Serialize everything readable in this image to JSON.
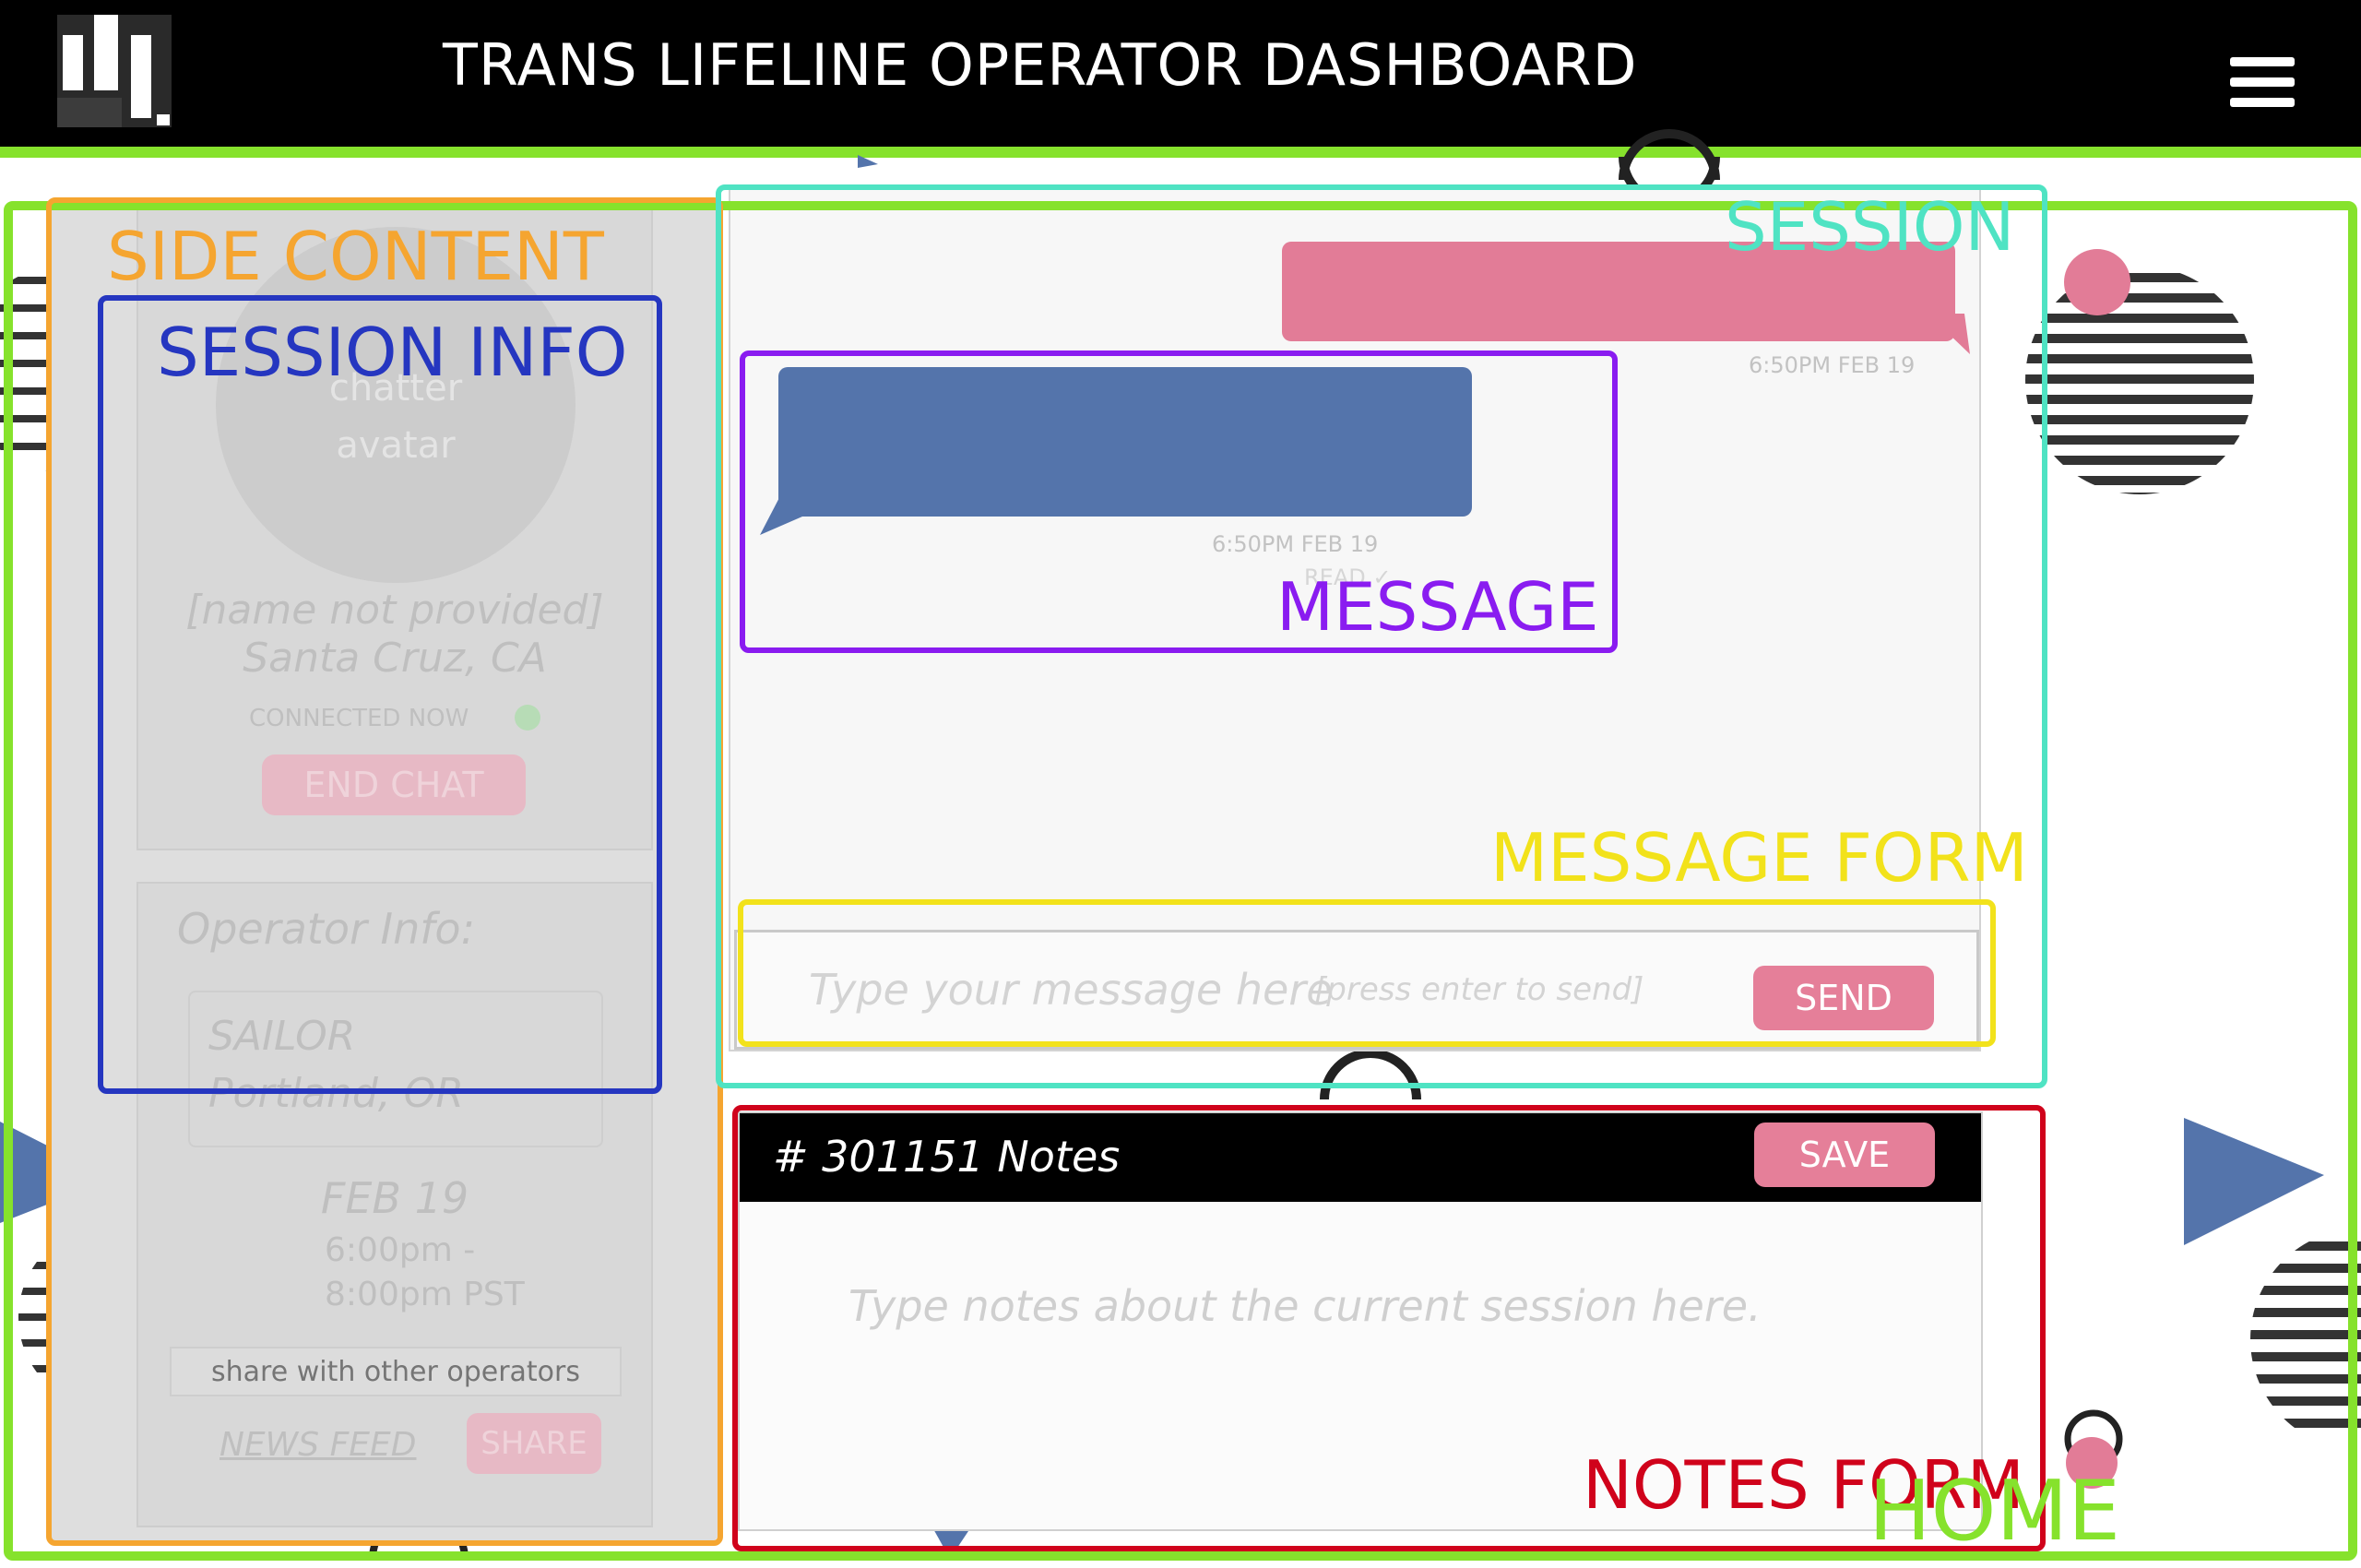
{
  "header": {
    "title": "TRANS LIFELINE OPERATOR DASHBOARD",
    "logo_icon": "trans-lifeline-logo",
    "menu_icon": "hamburger-menu-icon"
  },
  "side_content": {
    "session_info": {
      "avatar_text": "chatter\navatar",
      "name": "[name not provided]",
      "location": "Santa Cruz, CA",
      "status": "CONNECTED NOW",
      "end_chat_label": "END CHAT"
    },
    "operator_info": {
      "heading": "Operator Info:",
      "name": "SAILOR",
      "location": "Portland, OR",
      "shift_date": "FEB 19",
      "shift_time": "6:00pm -\n8:00pm PST",
      "share_placeholder": "share with other operators",
      "news_feed_label": "NEWS FEED",
      "share_label": "SHARE"
    }
  },
  "session": {
    "messages": [
      {
        "direction": "outgoing",
        "timestamp": "6:50PM FEB 19"
      },
      {
        "direction": "incoming",
        "timestamp": "6:50PM FEB 19",
        "read": "READ ✓"
      }
    ],
    "message_form": {
      "placeholder": "Type your message here",
      "hint": "[press enter to send]",
      "send_label": "SEND"
    }
  },
  "notes_form": {
    "title": "# 301151 Notes",
    "save_label": "SAVE",
    "placeholder": "Type notes about the current session here."
  },
  "annotations": {
    "home": "HOME",
    "side_content": "SIDE CONTENT",
    "session_info": "SESSION INFO",
    "session": "SESSION",
    "message": "MESSAGE",
    "message_form": "MESSAGE FORM",
    "notes_form": "NOTES FORM"
  },
  "colors": {
    "home": "#86e22c",
    "side_content": "#f5a530",
    "session_info": "#2536c0",
    "session": "#4fe3c3",
    "message": "#8a1cf0",
    "message_form": "#f2e21b",
    "notes_form": "#d0021b",
    "bubble_outgoing": "#e27c97",
    "bubble_incoming": "#5474ab",
    "button_pink": "#e57f99"
  }
}
